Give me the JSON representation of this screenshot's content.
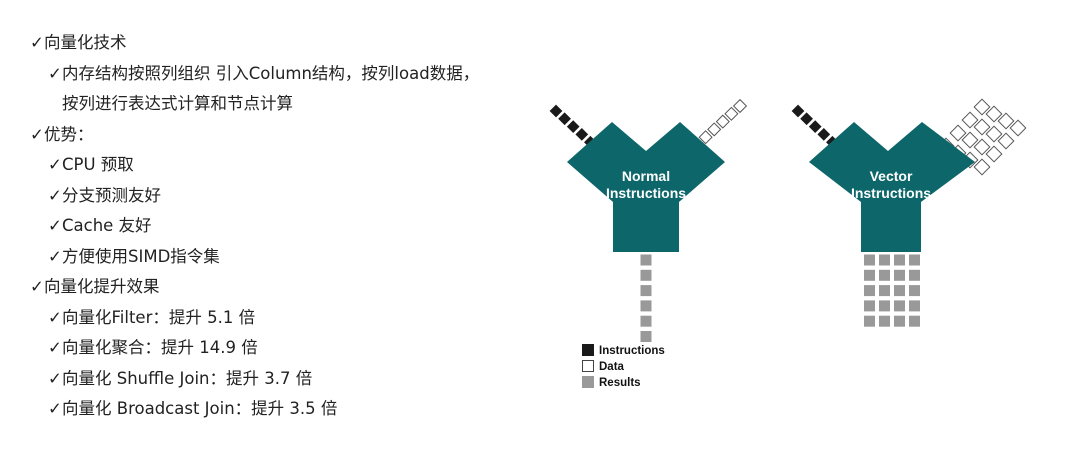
{
  "check_mark": "✓",
  "bullets": [
    {
      "level": 1,
      "text": "向量化技术"
    },
    {
      "level": 2,
      "text": "内存结构按照列组织 引入Column结构，按列load数据，"
    },
    {
      "level": 3,
      "text": "按列进行表达式计算和节点计算"
    },
    {
      "level": 1,
      "text": "优势："
    },
    {
      "level": 2,
      "text": "CPU 预取"
    },
    {
      "level": 2,
      "text": "分支预测友好"
    },
    {
      "level": 2,
      "text": "Cache 友好"
    },
    {
      "level": 2,
      "text": "方便使用SIMD指令集"
    },
    {
      "level": 1,
      "text": "向量化提升效果"
    },
    {
      "level": 2,
      "text": "向量化Filter：提升 5.1 倍"
    },
    {
      "level": 2,
      "text": "向量化聚合：提升 14.9 倍"
    },
    {
      "level": 2,
      "text": "向量化 Shuffle Join：提升 3.7 倍"
    },
    {
      "level": 2,
      "text": "向量化 Broadcast Join：提升 3.5 倍"
    }
  ],
  "diagram": {
    "normal": {
      "line1": "Normal",
      "line2": "Instructions"
    },
    "vector": {
      "line1": "Vector",
      "line2": "Instructions"
    },
    "legend": {
      "instructions": "Instructions",
      "data": "Data",
      "results": "Results"
    },
    "colors": {
      "body": "#0d6669",
      "instructions": "#1a1a1a",
      "data_fill": "#ffffff",
      "data_stroke": "#555555",
      "results": "#999999"
    }
  }
}
